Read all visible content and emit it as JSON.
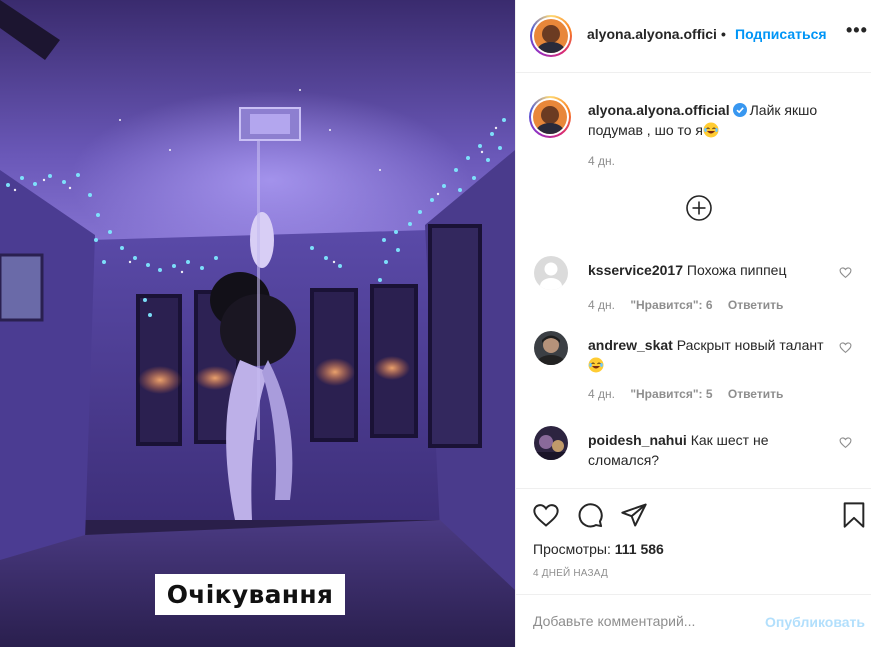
{
  "media": {
    "caption_overlay": "Очікування"
  },
  "header": {
    "username": "alyona.alyona.offici",
    "separator": "•",
    "follow_label": "Подписаться",
    "more_label": "•••"
  },
  "post": {
    "owner_username": "alyona.alyona.official",
    "caption": "Лайк якшо подумав , шо то я",
    "caption_emoji": "laughing-emoji",
    "time": "4 дн.",
    "load_more_icon": "plus-circle-icon"
  },
  "comments": [
    {
      "username": "ksservice2017",
      "text": "Похожа пиппец",
      "time": "4 дн.",
      "likes": "\"Нравится\": 6",
      "reply": "Ответить"
    },
    {
      "username": "andrew_skat",
      "text": "Раскрыт новый талант",
      "emoji": "laughing-emoji",
      "time": "4 дн.",
      "likes": "\"Нравится\": 5",
      "reply": "Ответить"
    },
    {
      "username": "poidesh_nahui",
      "text": "Как шест не сломался?"
    }
  ],
  "actions": {
    "icons": [
      "heart-icon",
      "comment-icon",
      "share-icon",
      "bookmark-icon"
    ],
    "views_label": "Просмотры:",
    "views_count": "111 586",
    "date": "4 дней назад"
  },
  "add_comment": {
    "placeholder": "Добавьте комментарий...",
    "publish_label": "Опубликовать"
  },
  "colors": {
    "accent": "#0095f6",
    "publish_disabled": "#b2dffc",
    "meta_gray": "#8e8e8e",
    "text": "#262626"
  }
}
